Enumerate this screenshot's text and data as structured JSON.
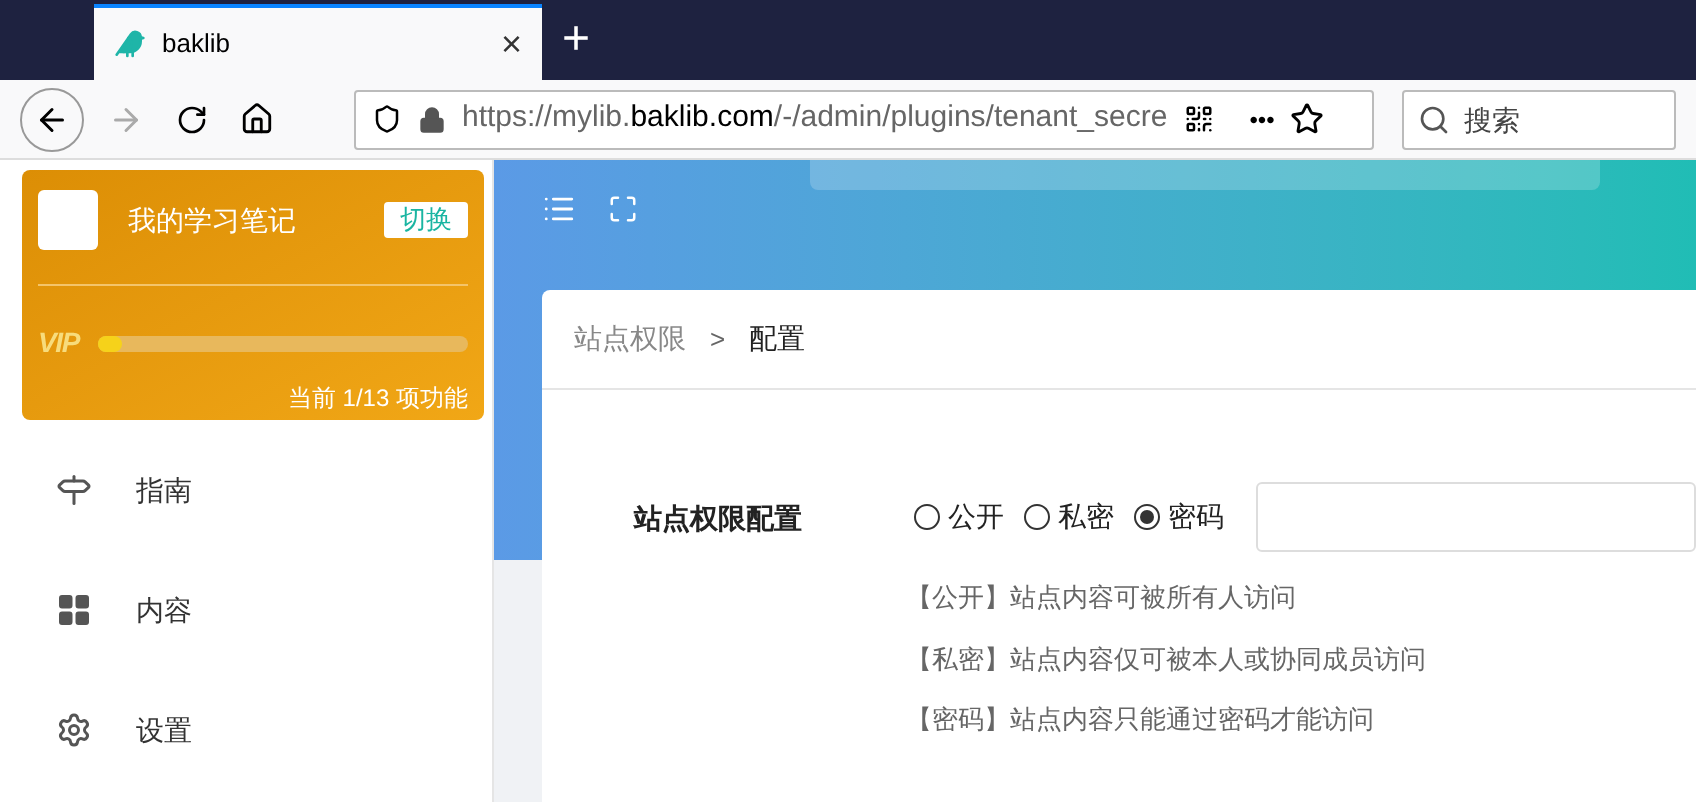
{
  "browser": {
    "tab": {
      "title": "baklib",
      "close": "×"
    },
    "new_tab": "+",
    "url": "https://mylib.**baklib.com**/-/admin/plugins/tenant_secre",
    "more": "•••",
    "search": {
      "placeholder": "搜索"
    }
  },
  "sidebar": {
    "card": {
      "title": "我的学习笔记",
      "switch_button": "切换",
      "vip_label": "VIP",
      "level": 0.06,
      "progress_text": "当前 1/13 项功能"
    },
    "items": [
      {
        "kind": "guide",
        "label": "指南"
      },
      {
        "kind": "content",
        "label": "内容"
      },
      {
        "kind": "settings",
        "label": "设置"
      }
    ]
  },
  "breadcrumb": [
    {
      "label": "站点权限",
      "current": false
    },
    {
      "label": "配置",
      "current": true
    }
  ],
  "breadcrumb_separator": ">",
  "form": {
    "label": "站点权限配置",
    "options": [
      {
        "label": "公开",
        "selected": false
      },
      {
        "label": "私密",
        "selected": false
      },
      {
        "label": "密码",
        "selected": true
      }
    ],
    "notes": [
      "【公开】站点内容可被所有人访问",
      "【私密】站点内容仅可被本人或协同成员访问",
      "【密码】站点内容只能通过密码才能访问"
    ]
  }
}
